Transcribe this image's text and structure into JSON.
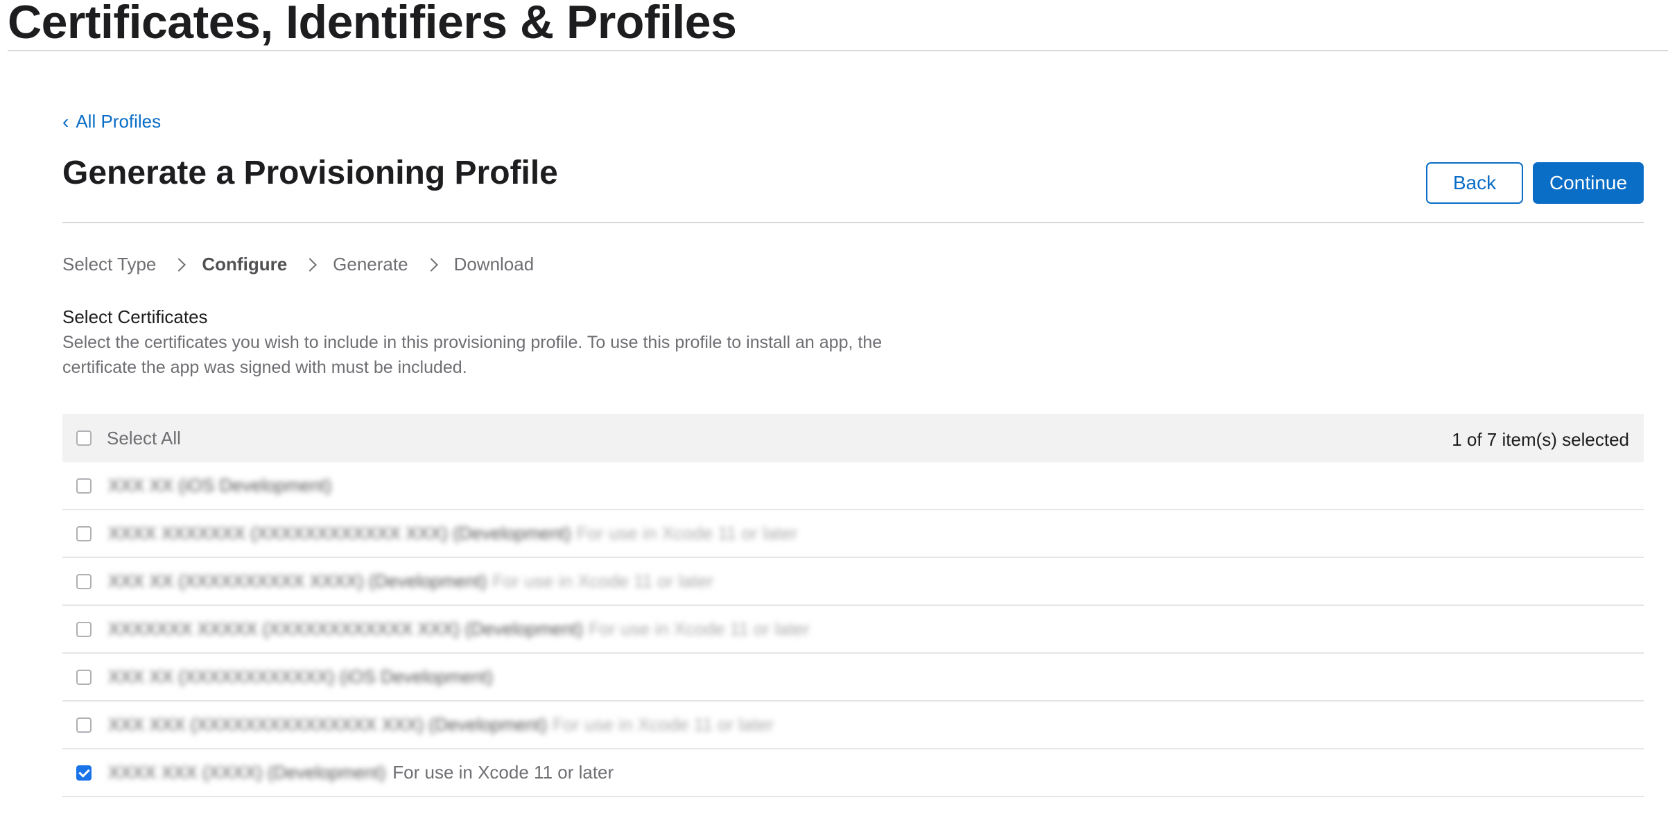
{
  "header": {
    "title": "Certificates, Identifiers & Profiles"
  },
  "breadcrumb": {
    "back_label": "All Profiles"
  },
  "page": {
    "title": "Generate a Provisioning Profile",
    "back_button": "Back",
    "continue_button": "Continue"
  },
  "steps": [
    {
      "label": "Select Type",
      "active": false
    },
    {
      "label": "Configure",
      "active": true
    },
    {
      "label": "Generate",
      "active": false
    },
    {
      "label": "Download",
      "active": false
    }
  ],
  "section": {
    "title": "Select Certificates",
    "description": "Select the certificates you wish to include in this provisioning profile. To use this profile to install an app, the certificate the app was signed with must be included."
  },
  "table": {
    "select_all_label": "Select All",
    "selected_count": "1 of 7 item(s) selected",
    "rows": [
      {
        "name": "XXX XX (iOS Development)",
        "note": "",
        "checked": false
      },
      {
        "name": "XXXX XXXXXXX (XXXXXXXXXXXX XXX) (Development)",
        "note": "For use in Xcode 11 or later",
        "checked": false
      },
      {
        "name": "XXX XX (XXXXXXXXXX XXXX) (Development)",
        "note": "For use in Xcode 11 or later",
        "checked": false
      },
      {
        "name": "XXXXXXX XXXXX (XXXXXXXXXXXX XXX) (Development)",
        "note": "For use in Xcode 11 or later",
        "checked": false
      },
      {
        "name": "XXX XX (XXXXXXXXXXXX) (iOS Development)",
        "note": "",
        "checked": false
      },
      {
        "name": "XXX XXX (XXXXXXXXXXXXXXX XXX) (Development)",
        "note": "For use in Xcode 11 or later",
        "checked": false
      },
      {
        "name": "XXXX XXX (XXXX) (Development)",
        "note": "For use in Xcode 11 or later",
        "checked": true
      }
    ]
  },
  "colors": {
    "accent": "#0a6dc6",
    "checkbox_checked": "#1a73e8",
    "header_bg": "#f2f2f2"
  }
}
